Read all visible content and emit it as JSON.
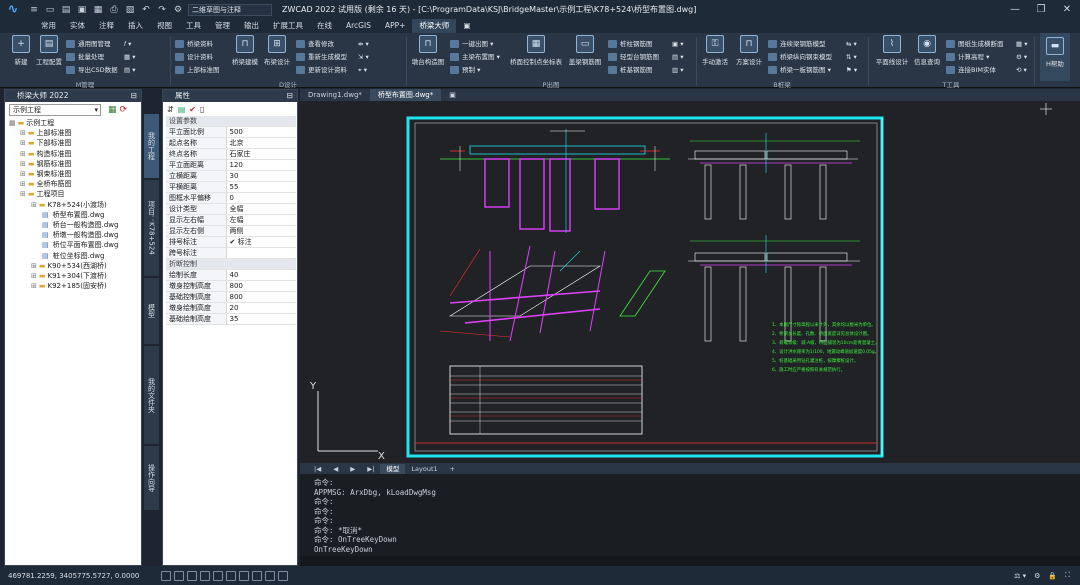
{
  "titlebar": {
    "workspace": "二维草图与注释",
    "title": "ZWCAD 2022 试用版 (剩余 16 天) - [C:\\ProgramData\\KSJ\\BridgeMaster\\示例工程\\K78+524\\桥型布置图.dwg]"
  },
  "menu": {
    "tabs": [
      "常用",
      "实体",
      "注释",
      "插入",
      "视图",
      "工具",
      "管理",
      "输出",
      "扩展工具",
      "在线",
      "ArcGIS",
      "APP+",
      "桥梁大师"
    ],
    "active_index": 12
  },
  "ribbon": {
    "m_group": {
      "label": "M管理",
      "big_buttons": [
        "新建",
        "工程配置"
      ],
      "small_buttons": [
        "通用图管理",
        "批量处理",
        "导出CSD数据"
      ]
    },
    "d_group": {
      "label": "D设计",
      "small_buttons_a": [
        "桥梁资料",
        "设计资料",
        "上部标准图"
      ],
      "big_buttons": [
        "桥梁建模",
        "布梁设计"
      ],
      "small_buttons_b": [
        "查看修改",
        "重新生成模型",
        "更新设计资料"
      ]
    },
    "p_group": {
      "label": "P出图",
      "big_buttons": [
        "墩台构造图"
      ],
      "small_buttons_a": [
        "一键出图",
        "主梁布置图",
        "预制"
      ],
      "big_buttons_b": [
        "桥面控制点坐标表",
        "盖梁钢筋图"
      ],
      "small_buttons_b": [
        "桩柱钢筋图",
        "轻型台钢筋图",
        "桩基钢筋图"
      ]
    },
    "b_group": {
      "label": "B桩梁",
      "big_buttons": [
        "手动激活",
        "方案设计"
      ],
      "small_buttons": [
        "连续梁钢筋模型",
        "桥梁纵向钢束模型",
        "桥梁一板钢筋图"
      ]
    },
    "t_group": {
      "label": "T工具",
      "big_buttons": [
        "平面线设计",
        "信息查询"
      ],
      "small_buttons": [
        "图纸生成横断面",
        "计算高程",
        "连接BIM实体"
      ]
    },
    "h_group": {
      "big_buttons": [
        "H帮助"
      ]
    }
  },
  "left_panel": {
    "title": "桥梁大师 2022",
    "project_select": "示例工程",
    "tree": [
      {
        "level": 0,
        "text": "示例工程"
      },
      {
        "level": 1,
        "text": "上部标准图"
      },
      {
        "level": 1,
        "text": "下部标准图"
      },
      {
        "level": 1,
        "text": "构造标准图"
      },
      {
        "level": 1,
        "text": "钢筋标准图"
      },
      {
        "level": 1,
        "text": "钢束标准图"
      },
      {
        "level": 1,
        "text": "全桥布筋图"
      },
      {
        "level": 1,
        "text": "工程项目"
      },
      {
        "level": 2,
        "text": "K78+524(小渡场)"
      },
      {
        "level": 3,
        "text": "桥型布置图.dwg"
      },
      {
        "level": 3,
        "text": "桥台一般构造图.dwg"
      },
      {
        "level": 3,
        "text": "桥墩一般构造图.dwg"
      },
      {
        "level": 3,
        "text": "桥位平面布置图.dwg"
      },
      {
        "level": 3,
        "text": "桩位坐标图.dwg"
      },
      {
        "level": 2,
        "text": "K90+534(西湖桥)"
      },
      {
        "level": 2,
        "text": "K91+304(下渡桥)"
      },
      {
        "level": 2,
        "text": "K92+185(固安桥)"
      }
    ]
  },
  "vertical_tabs": [
    "我的工程",
    "项目：K78+524",
    "模型",
    "我的文件夹",
    "操作向导"
  ],
  "properties": {
    "title": "属性",
    "sections": [
      {
        "name": "设置参数",
        "rows": [
          [
            "平立面比例",
            "500"
          ],
          [
            "起点名称",
            "北京"
          ],
          [
            "终点名称",
            "石家庄"
          ],
          [
            "平立面距离",
            "120"
          ],
          [
            "立横距离",
            "30"
          ],
          [
            "平横距离",
            "55"
          ],
          [
            "图框水平偏移",
            "0"
          ],
          [
            "设计类型",
            "全幅"
          ],
          [
            "显示左右幅",
            "左幅"
          ],
          [
            "显示左右侧",
            "两侧"
          ],
          [
            "排号标注",
            "✔ 标注"
          ],
          [
            "跨号标注",
            ""
          ]
        ]
      },
      {
        "name": "折断控制",
        "rows": [
          [
            "绘制长度",
            "40"
          ],
          [
            "墩身控制高度",
            "800"
          ],
          [
            "基础控制高度",
            "800"
          ],
          [
            "墩身绘制高度",
            "20"
          ],
          [
            "基础绘制高度",
            "35"
          ]
        ]
      }
    ]
  },
  "doc_tabs": [
    "Drawing1.dwg*",
    "桥型布置图.dwg*"
  ],
  "doc_active_index": 1,
  "layout_tabs": [
    "模型",
    "Layout1",
    "+"
  ],
  "layout_active_index": 0,
  "command_history": [
    "命令:",
    "APPMSG: ArxDbg, kLoadDwgMsg",
    "命令:",
    "命令:",
    "命令:",
    "命令: *取消*",
    "命令: OnTreeKeyDown",
    "OnTreeKeyDown"
  ],
  "status": {
    "coordinates": "469781.2259, 3405775.5727, 0.0000"
  },
  "drawing": {
    "note_lines": [
      "1、本图尺寸除高程以米计外，其余均以厘米为单位。",
      "2、桥梁总长度、孔数、桥面宽度详见总体设计图。",
      "3、荷载等级：城-A级，桥面铺装为10cm沥青混凝土。",
      "4、设计洪水频率为1/100，地震动峰值加速度0.05g。",
      "5、桩基础采用钻孔灌注桩，按摩擦桩设计。",
      "6、施工时应严格按照有关规范执行。"
    ]
  },
  "colors": {
    "frame": "#1ee5f0",
    "accent": "#4aa8ff",
    "magenta": "#e040ff",
    "green": "#3ef03e"
  }
}
